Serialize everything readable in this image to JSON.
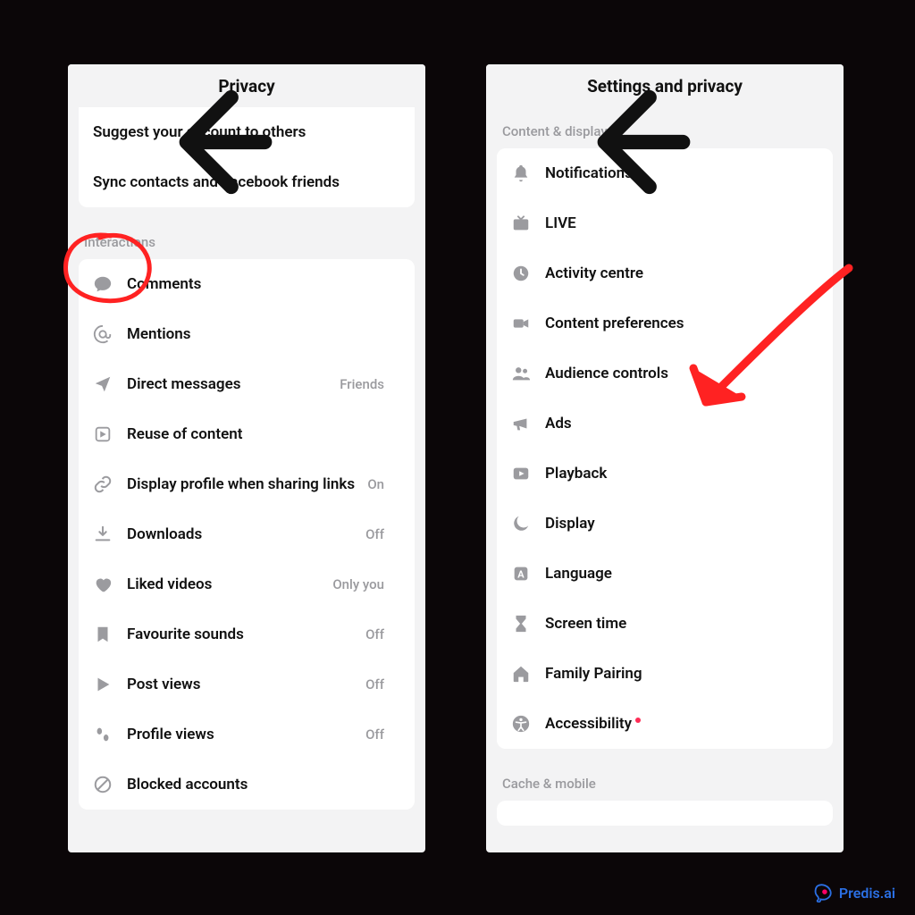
{
  "watermark": "Predis.ai",
  "left": {
    "title": "Privacy",
    "top_items": [
      {
        "label": "Suggest your account to others"
      },
      {
        "label": "Sync contacts and Facebook friends"
      }
    ],
    "section_header": "Interactions",
    "items": [
      {
        "icon": "comment",
        "label": "Comments",
        "value": ""
      },
      {
        "icon": "at",
        "label": "Mentions",
        "value": ""
      },
      {
        "icon": "send",
        "label": "Direct messages",
        "value": "Friends"
      },
      {
        "icon": "reuse",
        "label": "Reuse of content",
        "value": ""
      },
      {
        "icon": "link",
        "label": "Display profile when sharing links",
        "value": "On"
      },
      {
        "icon": "download",
        "label": "Downloads",
        "value": "Off"
      },
      {
        "icon": "heart",
        "label": "Liked videos",
        "value": "Only you"
      },
      {
        "icon": "bookmark",
        "label": "Favourite sounds",
        "value": "Off"
      },
      {
        "icon": "play",
        "label": "Post views",
        "value": "Off"
      },
      {
        "icon": "footsteps",
        "label": "Profile views",
        "value": "Off"
      },
      {
        "icon": "block",
        "label": "Blocked accounts",
        "value": ""
      }
    ]
  },
  "right": {
    "title": "Settings and privacy",
    "section_header": "Content & display",
    "items": [
      {
        "icon": "bell",
        "label": "Notifications"
      },
      {
        "icon": "tv",
        "label": "LIVE"
      },
      {
        "icon": "clock",
        "label": "Activity centre"
      },
      {
        "icon": "video",
        "label": "Content preferences"
      },
      {
        "icon": "people",
        "label": "Audience controls"
      },
      {
        "icon": "megaphone",
        "label": "Ads"
      },
      {
        "icon": "playback",
        "label": "Playback"
      },
      {
        "icon": "moon",
        "label": "Display"
      },
      {
        "icon": "lang",
        "label": "Language"
      },
      {
        "icon": "hourglass",
        "label": "Screen time"
      },
      {
        "icon": "home",
        "label": "Family Pairing"
      },
      {
        "icon": "access",
        "label": "Accessibility",
        "dot": true
      }
    ],
    "section_header2": "Cache & mobile"
  }
}
